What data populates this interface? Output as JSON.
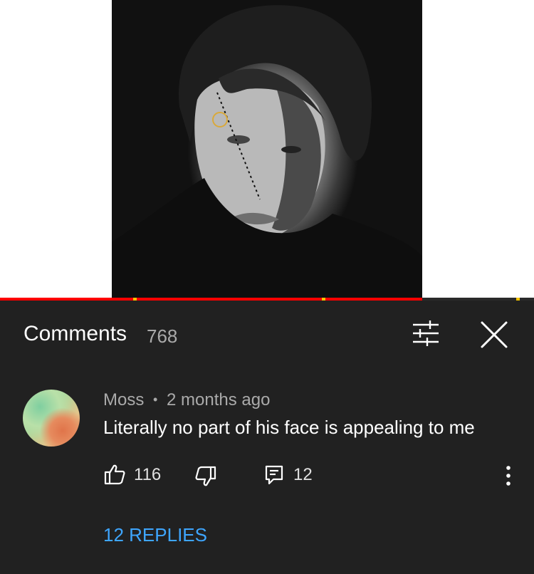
{
  "comments_panel": {
    "title": "Comments",
    "count": "768"
  },
  "comment": {
    "author": "Moss",
    "separator": "•",
    "time": "2 months ago",
    "text": "Literally no part of his face is appealing to me",
    "likes": "116",
    "reply_count": "12",
    "replies_link": "12 REPLIES"
  },
  "icons": {
    "filter": "sliders-icon",
    "close": "close-icon",
    "like": "thumbs-up-icon",
    "dislike": "thumbs-down-icon",
    "reply": "reply-icon",
    "more": "more-vertical-icon"
  },
  "colors": {
    "panel_bg": "#212121",
    "progress_played": "#ff0000",
    "ad_marker": "#f2c200",
    "link_blue": "#3ea6ff"
  }
}
